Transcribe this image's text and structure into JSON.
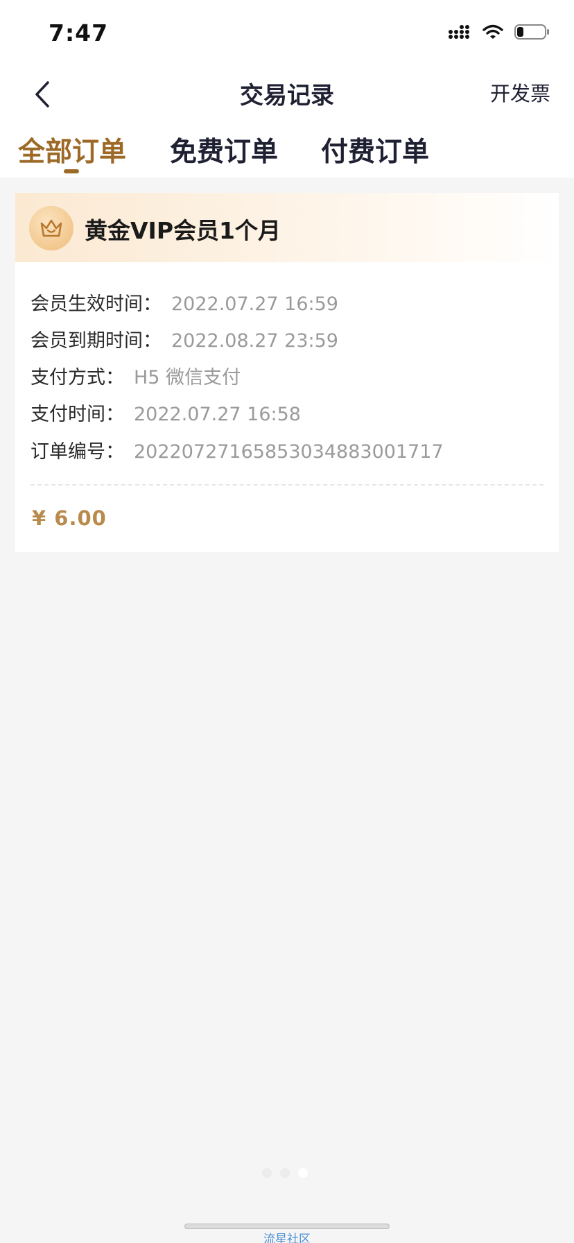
{
  "status_bar": {
    "time": "7:47"
  },
  "nav": {
    "title": "交易记录",
    "right_action": "开发票"
  },
  "tabs": [
    {
      "label": "全部订单",
      "active": true
    },
    {
      "label": "免费订单",
      "active": false
    },
    {
      "label": "付费订单",
      "active": false
    }
  ],
  "order": {
    "title": "黄金VIP会员1个月",
    "rows": [
      {
        "label": "会员生效时间：",
        "value": "2022.07.27 16:59"
      },
      {
        "label": "会员到期时间：",
        "value": "2022.08.27 23:59"
      },
      {
        "label": "支付方式：",
        "value": "H5 微信支付"
      },
      {
        "label": "支付时间：",
        "value": "2022.07.27 16:58"
      },
      {
        "label": "订单编号：",
        "value": "2022072716585303488300171​7"
      }
    ],
    "price": "¥ 6.00"
  },
  "bottom_caption": "流星社区",
  "colors": {
    "accent": "#9c6a26",
    "price": "#b88a4c",
    "text_dark": "#1f2133",
    "value_gray": "#9a9a9a"
  },
  "icons": {
    "back": "chevron-left-icon",
    "crown": "crown-icon",
    "signal": "cellular-signal-icon",
    "wifi": "wifi-icon",
    "battery": "battery-icon"
  }
}
